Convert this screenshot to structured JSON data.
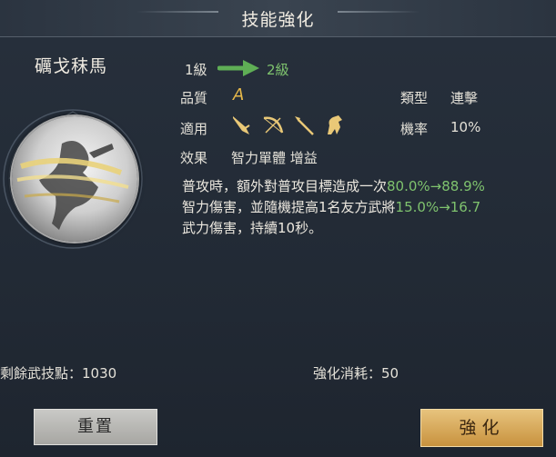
{
  "window": {
    "title": "技能強化"
  },
  "skill": {
    "name": "礪戈秣馬",
    "level_from": "1級",
    "level_to": "2級",
    "quality_label": "品質",
    "quality_value": "A",
    "type_label": "類型",
    "type_value": "連擊",
    "applicable_label": "適用",
    "applicable_icons": [
      "sword-icon",
      "bow-icon",
      "spear-icon",
      "horse-icon"
    ],
    "chance_label": "機率",
    "chance_value": "10%",
    "effect_label": "效果",
    "effect_value": "智力單體 增益",
    "description": {
      "line1_text": "普攻時，額外對普攻目標造成一次",
      "line1_values": "80.0%→88.9%",
      "line2_text": "智力傷害，並隨機提高1名友方武將",
      "line2_values": "15.0%→16.7",
      "line3_text": "武力傷害，持續10秒。"
    }
  },
  "footer": {
    "remaining_label": "剩餘武技點：1030",
    "cost_label": "強化消耗：50"
  },
  "buttons": {
    "reset": "重置",
    "enhance": "強化"
  },
  "colors": {
    "accent_green": "#7fc36e",
    "quality_gold": "#e6b84a",
    "button_gold": "#d9a85a"
  }
}
